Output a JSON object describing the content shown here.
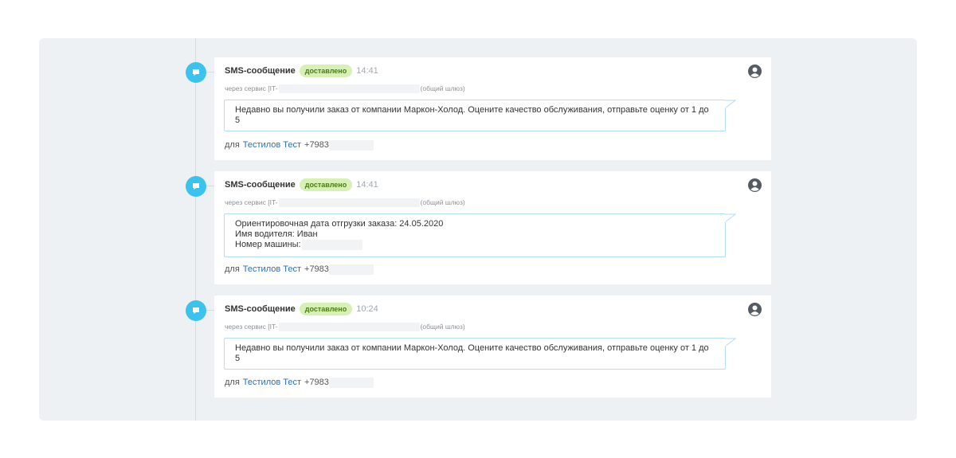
{
  "messages": [
    {
      "type_label": "SMS-сообщение",
      "status": "доставлено",
      "time": "14:41",
      "service_prefix": "через сервис [IT-",
      "service_suffix": "(общий шлюз)",
      "lines": [
        "Недавно вы получили заказ от компании Маркон-Холод. Оцените качество обслуживания, отправьте оценку от 1 до",
        "5"
      ],
      "recipient_prefix": "для",
      "recipient_name": "Тестилов Тест",
      "recipient_phone": "+7983"
    },
    {
      "type_label": "SMS-сообщение",
      "status": "доставлено",
      "time": "14:41",
      "service_prefix": "через сервис [IT-",
      "service_suffix": "(общий шлюз)",
      "lines": [
        "Ориентировочная дата отгрузки заказа: 24.05.2020",
        "Имя водителя: Иван",
        "Номер машины:"
      ],
      "recipient_prefix": "для",
      "recipient_name": "Тестилов Тест",
      "recipient_phone": "+7983"
    },
    {
      "type_label": "SMS-сообщение",
      "status": "доставлено",
      "time": "10:24",
      "service_prefix": "через сервис [IT-",
      "service_suffix": "(общий шлюз)",
      "lines": [
        "Недавно вы получили заказ от компании Маркон-Холод. Оцените качество обслуживания, отправьте оценку от 1 до",
        "5"
      ],
      "recipient_prefix": "для",
      "recipient_name": "Тестилов Тест",
      "recipient_phone": "+7983"
    }
  ],
  "icons": {
    "timeline": "chat-bubble-icon",
    "author": "user-avatar-icon"
  },
  "colors": {
    "accent": "#3bc3ee",
    "status_bg": "#d7f0b6",
    "status_text": "#4a7c12",
    "link": "#2a6fb5"
  }
}
